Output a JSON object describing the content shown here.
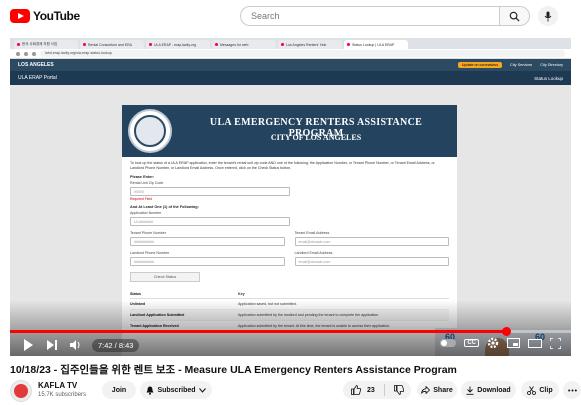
{
  "youtube": {
    "logo_text": "YouTube",
    "search_placeholder": "Search"
  },
  "browser": {
    "tabs": [
      "한국 사회경제 지원 사업",
      "Rental Consortium and ERA",
      "ULA ERAP - erap.lacity.org",
      "Messages for web",
      "Los Angeles Renters' Hub",
      "Status Lookup | ULA ERAP"
    ],
    "url": "lahd.erap.lacity.org/ula-erap-status-lookup"
  },
  "la_site": {
    "logo": "LOS ANGELES",
    "update_badge": "Update on coronavirus",
    "links": [
      "City Services",
      "City Directory"
    ],
    "portal_title": "ULA ERAP Portal",
    "status_lookup": "Status Lookup"
  },
  "form": {
    "title": "ULA EMERGENCY RENTERS ASSISTANCE PROGRAM",
    "subtitle": "CITY OF LOS ANGELES",
    "instructions": "To look up the status of a ULA ERAP application, enter the tenant's rental unit zip code AND one of the following: the Application Number, or Tenant Phone Number, or Tenant Email Address, or Landlord Phone Number, or Landlord Email Address. Once entered, click on the Check Status button.",
    "please_enter": "Please Enter:",
    "zip_label": "Rental Unit Zip Code",
    "zip_placeholder": "90000",
    "required_field": "Required Field",
    "one_of_label": "And At Least One (1) of the Following:",
    "app_number_label": "Application Number",
    "app_number_placeholder": "ULA######",
    "tenant_phone_label": "Tenant Phone Number",
    "tenant_phone_placeholder": "##########",
    "tenant_email_label": "Tenant Email Address",
    "tenant_email_placeholder": "email@domain.com",
    "landlord_phone_label": "Landlord Phone Number",
    "landlord_phone_placeholder": "##########",
    "landlord_email_label": "Landlord Email Address",
    "landlord_email_placeholder": "email@domain.com",
    "check_status_button": "Check Status",
    "table": {
      "headers": [
        "Status",
        "Key"
      ],
      "rows": [
        [
          "Unlinked",
          "Application saved, but not submitted."
        ],
        [
          "Landlord Application Submitted",
          "Application submitted by the landlord and pending the tenant to complete the application."
        ],
        [
          "Tenant Application Received",
          "Application submitted by the tenant. At this time, the tenant is unable to access their application."
        ]
      ]
    }
  },
  "player": {
    "time": "7:42 / 8:43",
    "progress_fraction": 0.885,
    "presenter_logo": "60"
  },
  "video": {
    "title": "10/18/23 - 집주인들을 위한 렌트 보조 - Measure ULA Emergency Renters Assistance Program",
    "channel": "KAFLA TV",
    "subscribers": "15.7K subscribers",
    "join": "Join",
    "subscribed": "Subscribed",
    "likes": "23",
    "share": "Share",
    "download": "Download",
    "clip": "Clip"
  },
  "colors": {
    "brand_red": "#ff0000",
    "banner_navy": "#24435f",
    "la_bar": "#2d4a63"
  }
}
